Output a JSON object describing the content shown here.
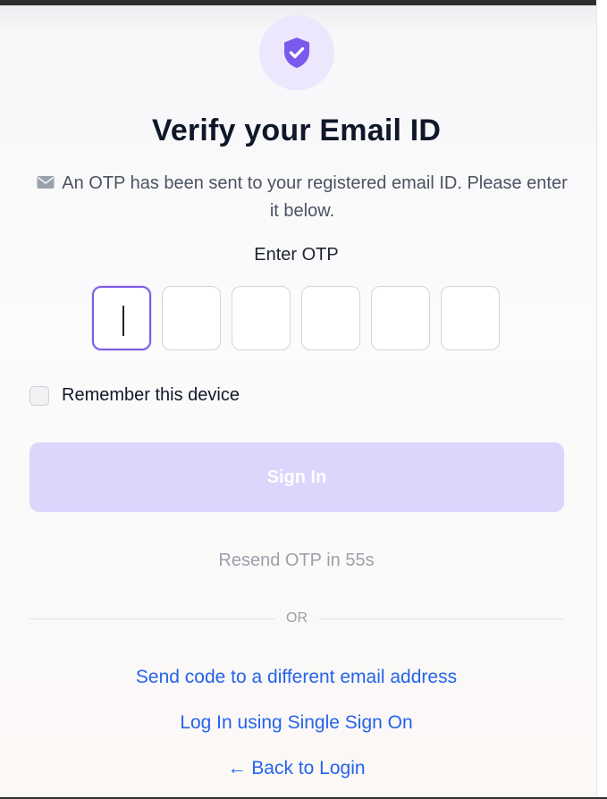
{
  "title": "Verify your Email ID",
  "subtitle": "An OTP has been sent to your registered email ID. Please enter it below.",
  "otp": {
    "label": "Enter OTP",
    "digits": [
      "",
      "",
      "",
      "",
      "",
      ""
    ],
    "active_index": 0
  },
  "remember": {
    "label": "Remember this device",
    "checked": false
  },
  "sign_in_label": "Sign In",
  "resend_text": "Resend OTP in 55s",
  "divider_text": "OR",
  "links": {
    "different_email": "Send code to a different email address",
    "sso": "Log In using Single Sign On",
    "back": "← Back to Login"
  },
  "icons": {
    "header": "shield-check-icon",
    "subtitle": "mail-icon"
  },
  "colors": {
    "accent": "#7c5ce6",
    "button_disabled": "#ddd5fb",
    "link": "#2463eb",
    "shield_bg": "#ece7fd"
  }
}
